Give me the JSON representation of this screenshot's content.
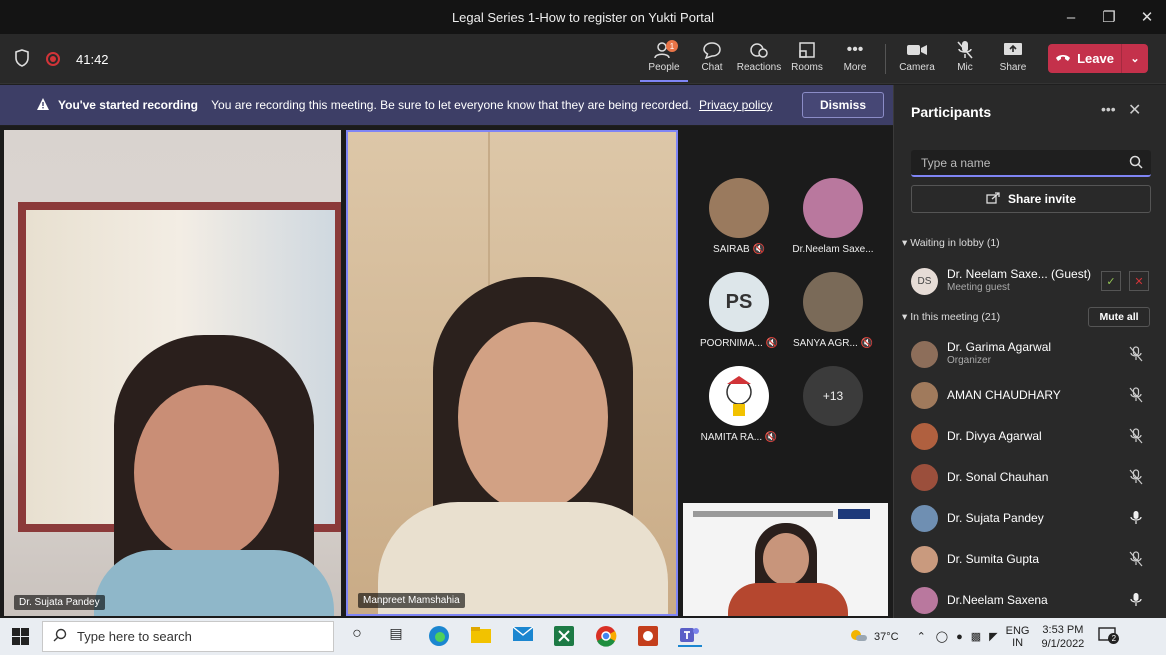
{
  "window": {
    "title": "Legal Series 1-How to register on Yukti Portal"
  },
  "toolbar": {
    "timer": "41:42",
    "people_label": "People",
    "people_badge": "1",
    "chat_label": "Chat",
    "reactions_label": "Reactions",
    "rooms_label": "Rooms",
    "more_label": "More",
    "camera_label": "Camera",
    "mic_label": "Mic",
    "share_label": "Share",
    "leave_label": "Leave"
  },
  "banner": {
    "title": "You've started recording",
    "message": "You are recording this meeting. Be sure to let everyone know that they are being recorded.",
    "link": "Privacy policy",
    "dismiss": "Dismiss"
  },
  "videos": {
    "left_name": "Dr. Sujata Pandey",
    "center_name": "Manpreet Mamshahia"
  },
  "tiles": [
    {
      "name": "SAIRAB",
      "initials": ""
    },
    {
      "name": "Dr.Neelam Saxe...",
      "initials": ""
    },
    {
      "name": "POORNIMA...",
      "initials": "PS"
    },
    {
      "name": "SANYA AGR...",
      "initials": ""
    },
    {
      "name": "NAMITA RA...",
      "initials": ""
    },
    {
      "name": "",
      "initials": "+13"
    }
  ],
  "panel": {
    "title": "Participants",
    "search_placeholder": "Type a name",
    "share_invite": "Share invite",
    "lobby_header": "Waiting in lobby (1)",
    "lobby_guest": {
      "initials": "DS",
      "name": "Dr. Neelam Saxe...  (Guest)",
      "sub": "Meeting guest"
    },
    "meeting_header": "In this meeting (21)",
    "mute_all": "Mute all",
    "participants": [
      {
        "name": "Dr. Garima Agarwal",
        "sub": "Organizer",
        "mic": "muted"
      },
      {
        "name": "AMAN CHAUDHARY",
        "sub": "",
        "mic": "muted"
      },
      {
        "name": "Dr. Divya Agarwal",
        "sub": "",
        "mic": "muted"
      },
      {
        "name": "Dr. Sonal Chauhan",
        "sub": "",
        "mic": "muted"
      },
      {
        "name": "Dr. Sujata Pandey",
        "sub": "",
        "mic": "on"
      },
      {
        "name": "Dr. Sumita Gupta",
        "sub": "",
        "mic": "muted"
      },
      {
        "name": "Dr.Neelam Saxena",
        "sub": "",
        "mic": "on"
      }
    ]
  },
  "taskbar": {
    "search_placeholder": "Type here to search",
    "weather": "37°C",
    "lang_top": "ENG",
    "lang_bottom": "IN",
    "time": "3:53 PM",
    "date": "9/1/2022",
    "notifications": "2"
  },
  "colors": {
    "accent": "#7f85f5",
    "leave": "#c4314b",
    "banner": "#3d3e66"
  }
}
